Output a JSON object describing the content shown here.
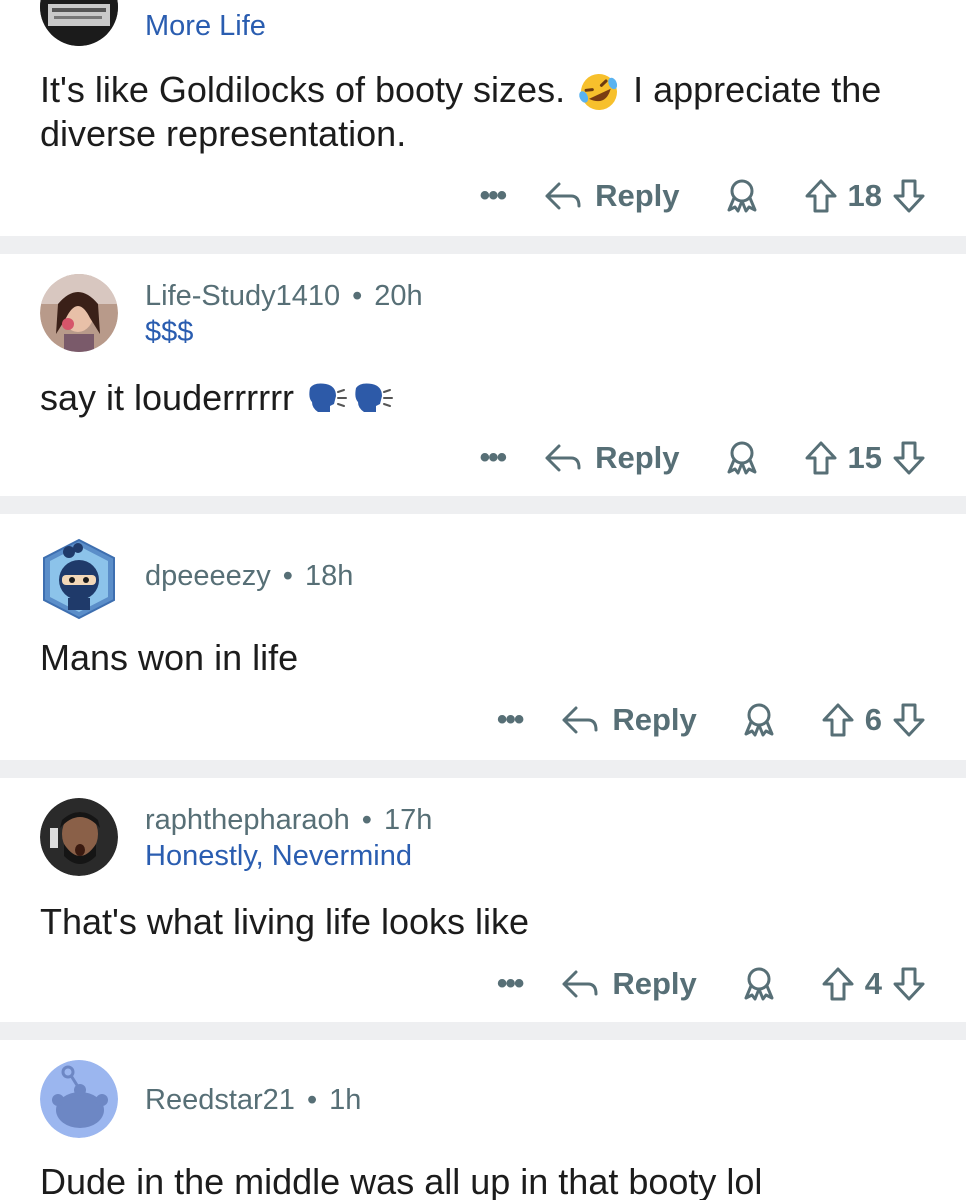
{
  "comments": [
    {
      "username": "",
      "time": "",
      "flair": "More Life",
      "text": "It's like Goldilocks of booty sizes.",
      "text_after_emoji": "I appreciate the diverse representation.",
      "emoji": "rolling-on-floor-laughing",
      "reply_label": "Reply",
      "votes": "18"
    },
    {
      "username": "Life-Study1410",
      "time": "20h",
      "flair": "$$$",
      "text": "say it louderrrrrr",
      "emoji": "speaking-head",
      "reply_label": "Reply",
      "votes": "15"
    },
    {
      "username": "dpeeeezy",
      "time": "18h",
      "flair": "",
      "text": "Mans won in life",
      "reply_label": "Reply",
      "votes": "6"
    },
    {
      "username": "raphthepharaoh",
      "time": "17h",
      "flair": "Honestly, Nevermind",
      "text": "That's what living life looks like",
      "reply_label": "Reply",
      "votes": "4"
    },
    {
      "username": "Reedstar21",
      "time": "1h",
      "flair": "",
      "text": "Dude in the middle was all up in that booty lol"
    }
  ],
  "dot": "•",
  "more_label": "•••",
  "colors": {
    "meta": "#576f76",
    "flair": "#2a5db0",
    "separator": "#eeeff1",
    "text": "#1c1c1c"
  }
}
